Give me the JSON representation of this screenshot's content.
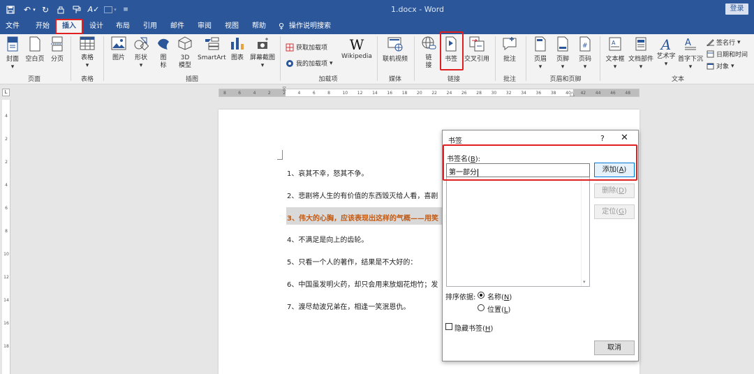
{
  "title_bar": {
    "doc_title": "1.docx - Word",
    "login": "登录",
    "quick_access": [
      "save-icon",
      "undo-icon",
      "redo-icon",
      "touch-icon",
      "format-painter-icon",
      "spelling-icon",
      "shape-icon",
      "customize-icon"
    ]
  },
  "tabs": [
    "文件",
    "开始",
    "插入",
    "设计",
    "布局",
    "引用",
    "邮件",
    "审阅",
    "视图",
    "帮助"
  ],
  "tell_me": "操作说明搜索",
  "ribbon": {
    "pages": {
      "cover": "封面",
      "blank": "空白页",
      "break": "分页",
      "group": "页面"
    },
    "tables": {
      "table": "表格",
      "group": "表格"
    },
    "illustrations": {
      "picture": "图片",
      "shapes": "形状",
      "icons": "图\n标",
      "model3d": "3D\n模型",
      "smartart": "SmartArt",
      "chart": "图表",
      "screenshot": "屏幕截图",
      "group": "插图"
    },
    "addins": {
      "get": "获取加载项",
      "my": "我的加载项",
      "wiki": "Wikipedia",
      "group": "加载项"
    },
    "media": {
      "video": "联机视频",
      "group": "媒体"
    },
    "links": {
      "link": "链\n接",
      "bookmark": "书签",
      "crossref": "交叉引用",
      "group": "链接"
    },
    "comments": {
      "comment": "批注",
      "group": "批注"
    },
    "header_footer": {
      "header": "页眉",
      "footer": "页脚",
      "page_number": "页码",
      "group": "页眉和页脚"
    },
    "text": {
      "textbox": "文本框",
      "quickparts": "文档部件",
      "wordart": "艺术字",
      "dropcap": "首字下沉",
      "sigline": "签名行",
      "datetime": "日期和时间",
      "object": "对象",
      "group": "文本"
    }
  },
  "ruler": {
    "ticks": [
      "8",
      "6",
      "4",
      "2",
      "2",
      "4",
      "6",
      "8",
      "10",
      "12",
      "14",
      "16",
      "18",
      "20",
      "22",
      "24",
      "26",
      "28",
      "30",
      "32",
      "34",
      "36",
      "38",
      "40",
      "42",
      "44",
      "46",
      "48"
    ]
  },
  "vruler": {
    "ticks": [
      "4",
      "2",
      "2",
      "4",
      "6",
      "8",
      "10",
      "12",
      "14",
      "16",
      "18"
    ]
  },
  "document": {
    "lines": [
      "1、哀其不幸，怒其不争。",
      "2、悲剧将人生的有价值的东西毁灭给人看，喜剧",
      "3、伟大的心胸，应该表现出这样的气概——用笑",
      "4、不满足是向上的齿轮。",
      "5、只看一个人的著作，结果是不大好的：",
      "6、中国虽发明火药，却只会用来放烟花炮竹；发",
      "7、渡尽劫波兄弟在，相逢一笑泯恩仇。"
    ]
  },
  "dialog": {
    "title": "书签",
    "help": "?",
    "close": "✕",
    "name_label_pre": "书签名(",
    "name_label_key": "B",
    "name_label_post": "):",
    "name_value": "第一部分",
    "add_pre": "添加(",
    "add_key": "A",
    "delete_pre": "删除(",
    "delete_key": "D",
    "goto_pre": "定位(",
    "goto_key": "G",
    "close_post": ")",
    "sort_label": "排序依据:",
    "sort_name_pre": "名称(",
    "sort_name_key": "N",
    "sort_location_pre": "位置(",
    "sort_location_key": "L",
    "hidden_pre": "隐藏书签(",
    "hidden_key": "H",
    "cancel": "取消"
  },
  "colors": {
    "ribbon_blue": "#2b579a",
    "highlight_text": "#c55a11",
    "annotation_red": "#e02020"
  }
}
